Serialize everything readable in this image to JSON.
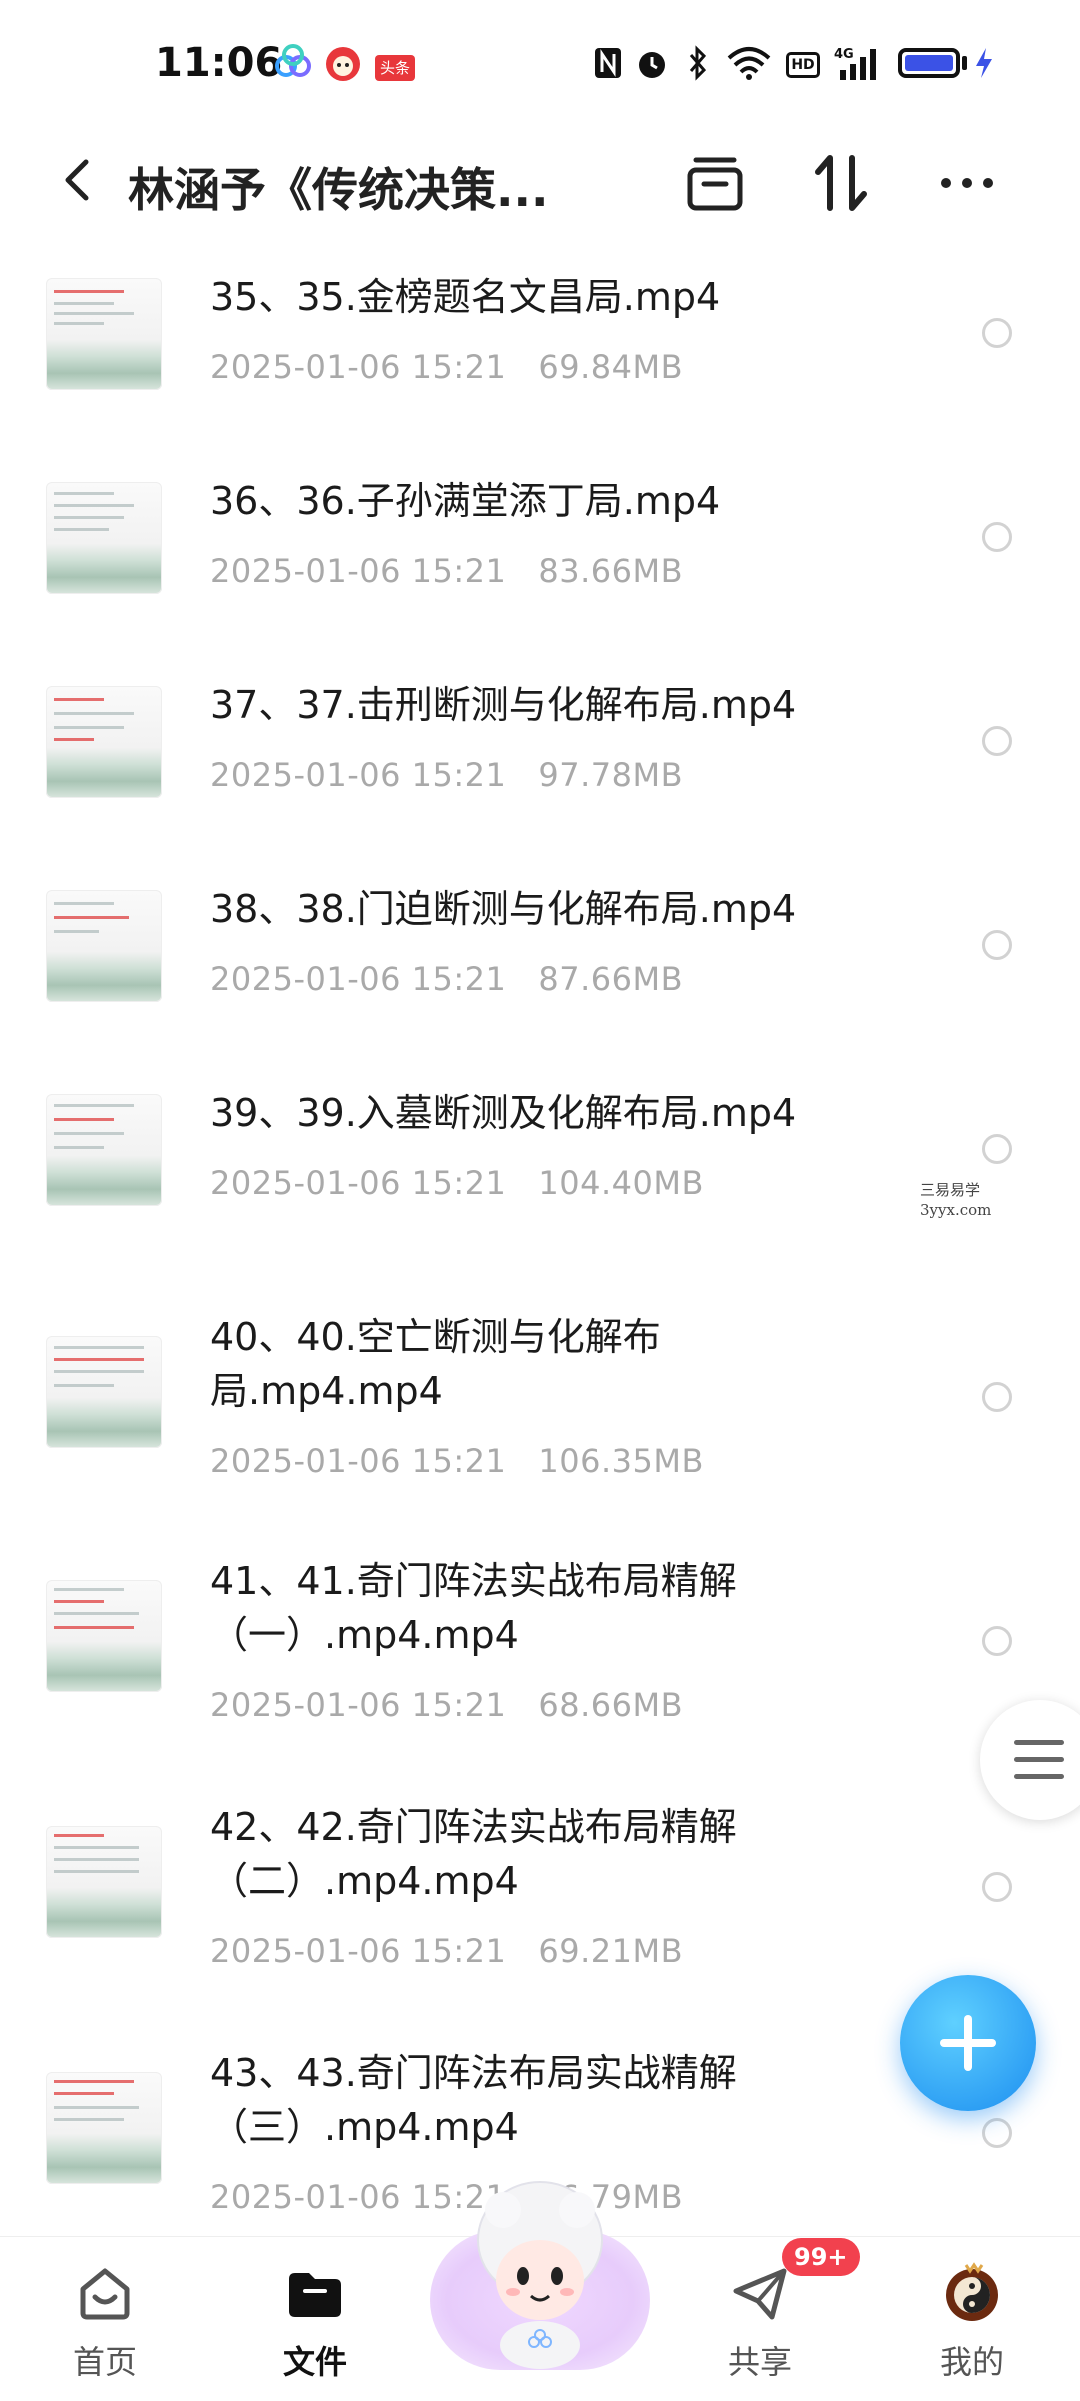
{
  "status_bar": {
    "time": "11:06",
    "toutiao_badge": "头条",
    "hd_label": "HD",
    "network": "4G"
  },
  "header": {
    "title": "林涵予《传统决策..."
  },
  "files": [
    {
      "name": "35、35.金榜题名文昌局.mp4",
      "date": "2025-01-06  15:21",
      "size": "69.84MB"
    },
    {
      "name": "36、36.子孙满堂添丁局.mp4",
      "date": "2025-01-06  15:21",
      "size": "83.66MB"
    },
    {
      "name": "37、37.击刑断测与化解布局.mp4",
      "date": "2025-01-06  15:21",
      "size": "97.78MB"
    },
    {
      "name": "38、38.门迫断测与化解布局.mp4",
      "date": "2025-01-06  15:21",
      "size": "87.66MB"
    },
    {
      "name": "39、39.入墓断测及化解布局.mp4",
      "date": "2025-01-06  15:21",
      "size": "104.40MB"
    },
    {
      "name": "40、40.空亡断测与化解布局.mp4.mp4",
      "date": "2025-01-06  15:21",
      "size": "106.35MB"
    },
    {
      "name": "41、41.奇门阵法实战布局精解（一）.mp4.mp4",
      "date": "2025-01-06  15:21",
      "size": "68.66MB"
    },
    {
      "name": "42、42.奇门阵法实战布局精解（二）.mp4.mp4",
      "date": "2025-01-06  15:21",
      "size": "69.21MB"
    },
    {
      "name": "43、43.奇门阵法布局实战精解（三）.mp4.mp4",
      "date": "2025-01-06  15:21",
      "size": "46.79MB"
    }
  ],
  "watermark": {
    "line1": "三易易学",
    "line2": "3yyx.com"
  },
  "tabs": [
    {
      "label": "首页",
      "icon": "home-icon"
    },
    {
      "label": "文件",
      "icon": "folder-icon",
      "active": true
    },
    {
      "label": "",
      "icon": "mascot-icon"
    },
    {
      "label": "共享",
      "icon": "send-icon",
      "badge": "99+"
    },
    {
      "label": "我的",
      "icon": "avatar-icon"
    }
  ],
  "colors": {
    "accent": "#1c8ef0",
    "badge": "#f2414e",
    "meta_text": "#a9a9a9"
  }
}
